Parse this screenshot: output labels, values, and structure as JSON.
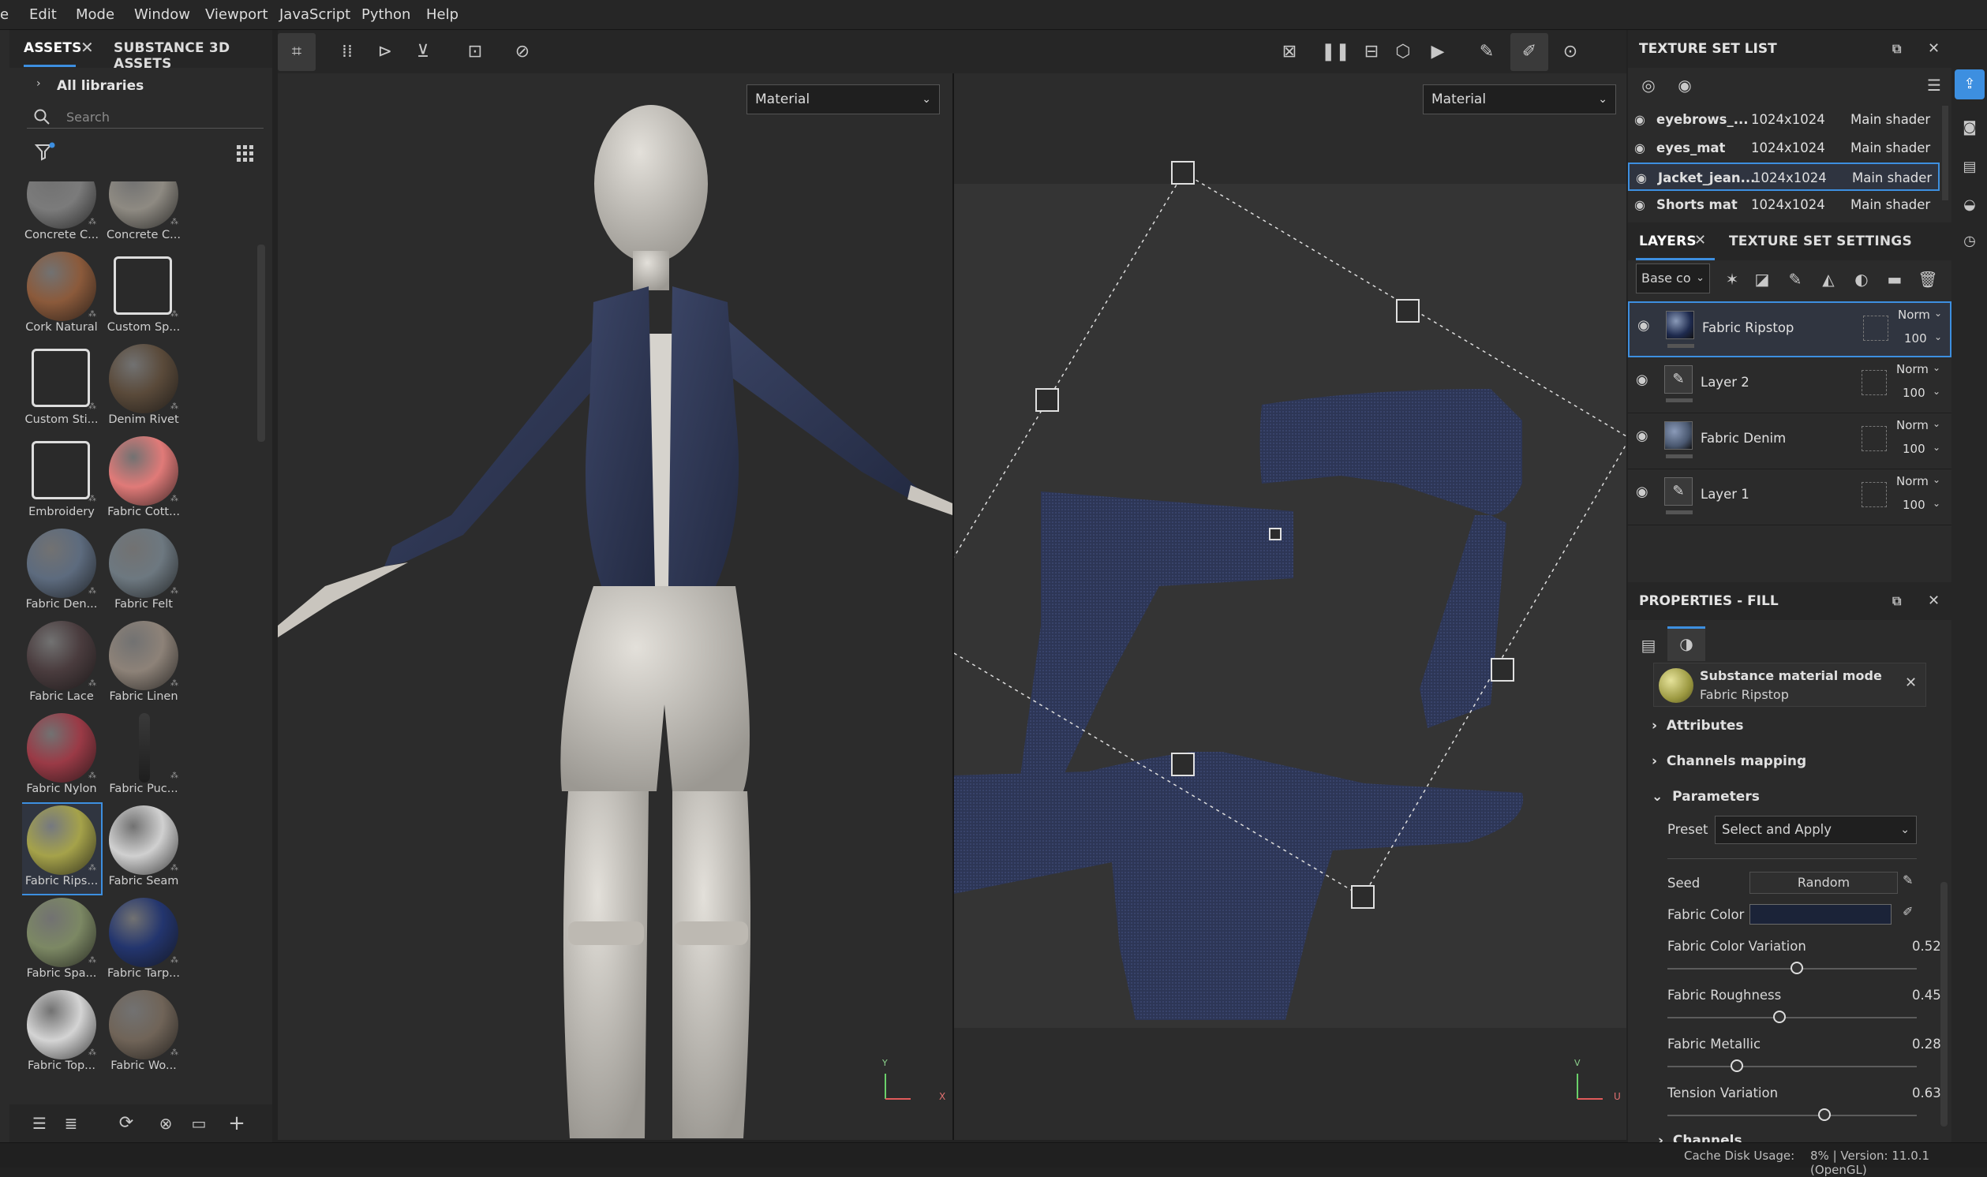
{
  "menubar": {
    "items": [
      "e",
      "Edit",
      "Mode",
      "Window",
      "Viewport",
      "JavaScript",
      "Python",
      "Help"
    ]
  },
  "assets": {
    "tab_assets": "ASSETS",
    "tab_substance": "SUBSTANCE 3D ASSETS",
    "all_libraries": "All libraries",
    "search_placeholder": "Search",
    "items": [
      {
        "label": "Concrete C...",
        "color": "#7b7b7b"
      },
      {
        "label": "Concrete C...",
        "color": "#8e8a82"
      },
      {
        "label": "Cork Natural",
        "color": "#8b5a3b"
      },
      {
        "label": "Custom Sp...",
        "color": "icon"
      },
      {
        "label": "Custom Sti...",
        "color": "icon"
      },
      {
        "label": "Denim Rivet",
        "color": "#5a4a3a"
      },
      {
        "label": "Embroidery",
        "color": "icon"
      },
      {
        "label": "Fabric Cott...",
        "color": "#e07a78"
      },
      {
        "label": "Fabric Den...",
        "color": "#5d6b7e"
      },
      {
        "label": "Fabric Felt",
        "color": "#6d7880"
      },
      {
        "label": "Fabric Lace",
        "color": "#4a3c3e"
      },
      {
        "label": "Fabric Linen",
        "color": "#8d8278"
      },
      {
        "label": "Fabric Nylon",
        "color": "#9a3a46"
      },
      {
        "label": "Fabric Puc...",
        "color": "puck"
      },
      {
        "label": "Fabric Rips...",
        "color": "#a5a24a"
      },
      {
        "label": "Fabric Seam",
        "color": "#d0d0d0"
      },
      {
        "label": "Fabric Spa...",
        "color": "#7c8864"
      },
      {
        "label": "Fabric Tarp...",
        "color": "#23356e"
      },
      {
        "label": "Fabric Top...",
        "color": "#d4d4d4"
      },
      {
        "label": "Fabric Wo...",
        "color": "#706458"
      }
    ]
  },
  "viewport": {
    "left_mode": "Material",
    "right_mode": "Material",
    "axis_left_y": "Y",
    "axis_left_x": "X",
    "axis_right_v": "V",
    "axis_right_u": "U"
  },
  "texture_set_list": {
    "title": "TEXTURE SET LIST",
    "rows": [
      {
        "name": "eyebrows_...",
        "res": "1024x1024",
        "shader": "Main shader"
      },
      {
        "name": "eyes_mat",
        "res": "1024x1024",
        "shader": "Main shader"
      },
      {
        "name": "Jacket_jean...",
        "res": "1024x1024",
        "shader": "Main shader"
      },
      {
        "name": "Shorts mat",
        "res": "1024x1024",
        "shader": "Main shader"
      }
    ]
  },
  "layers": {
    "tab_layers": "LAYERS",
    "tab_settings": "TEXTURE SET SETTINGS",
    "channel": "Base co",
    "rows": [
      {
        "name": "Fabric Ripstop",
        "blend": "Norm",
        "opacity": "100",
        "kind": "material",
        "color": "#1e2a4e"
      },
      {
        "name": "Layer 2",
        "blend": "Norm",
        "opacity": "100",
        "kind": "paint"
      },
      {
        "name": "Fabric Denim",
        "blend": "Norm",
        "opacity": "100",
        "kind": "material",
        "color": "#4a5870"
      },
      {
        "name": "Layer 1",
        "blend": "Norm",
        "opacity": "100",
        "kind": "paint"
      }
    ]
  },
  "properties": {
    "title": "PROPERTIES - FILL",
    "mode_title": "Substance material mode",
    "mode_material": "Fabric Ripstop",
    "sections": [
      "Attributes",
      "Channels mapping",
      "Parameters",
      "Channels"
    ],
    "preset_label": "Preset",
    "preset_value": "Select and Apply",
    "seed_label": "Seed",
    "seed_value": "Random",
    "fabric_color_label": "Fabric Color",
    "fabric_color": "#1b2338",
    "sliders": [
      {
        "label": "Fabric Color Variation",
        "value": "0.52",
        "fraction": 0.52
      },
      {
        "label": "Fabric Roughness",
        "value": "0.45",
        "fraction": 0.45
      },
      {
        "label": "Fabric Metallic",
        "value": "0.28",
        "fraction": 0.28
      },
      {
        "label": "Tension Variation",
        "value": "0.63",
        "fraction": 0.63
      }
    ]
  },
  "status": {
    "cache": "Cache Disk Usage:",
    "version": "8% | Version: 11.0.1 (OpenGL)"
  },
  "colors": {
    "accent": "#3d8fe0",
    "fabric": "#2a3352",
    "body": "#cfccc6"
  }
}
